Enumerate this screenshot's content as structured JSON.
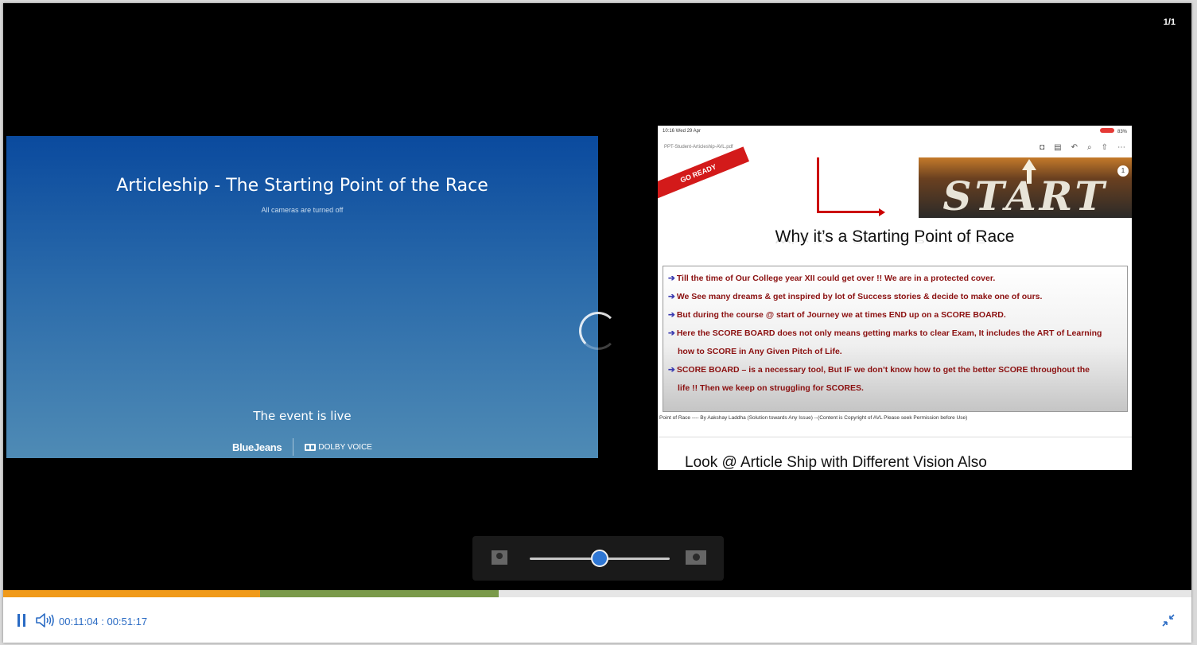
{
  "page_counter": "1/1",
  "event_panel": {
    "title": "Articleship - The Starting Point of the Race",
    "subtitle": "All cameras are turned off",
    "live_status": "The event is live",
    "brand_primary": "BlueJeans",
    "brand_secondary": "DOLBY VOICE"
  },
  "slide": {
    "status_time": "10:16  Wed 29 Apr",
    "status_battery": "83%",
    "file_name": "PPT-Student-Articleship-AVL.pdf",
    "ribbon_text": "GO READY",
    "start_text": "START",
    "page_badge": "1",
    "heading": "Why it’s a Starting Point of Race",
    "bullets": [
      "Till the time of Our College year XII could get over !! We are in a protected cover.",
      "We See many dreams & get inspired by lot of Success stories & decide to make one of ours.",
      "But during the course @ start of Journey we at times END up on a SCORE BOARD.",
      "Here the SCORE BOARD does not only means getting marks to clear Exam, It includes the ART of Learning",
      "how to SCORE in Any Given Pitch of Life.",
      "SCORE BOARD – is a necessary tool, But IF we don’t know how to get the better SCORE throughout the",
      "life !! Then we keep on struggling for SCORES."
    ],
    "footer": "Point of Race ---- By Aakshay Laddha (Solution towards Any Issue) --(Content is Copyright of AVL Please seek Permission before Use)",
    "next_heading": "Look @ Article Ship with Different Vision Also"
  },
  "layout_slider": {
    "value_fraction": 0.5
  },
  "playback": {
    "time": "00:11:04 : 00:51:17",
    "played_fraction": 0.216,
    "buffered_fraction": 0.417
  },
  "colors": {
    "accent": "#2a6bc4",
    "played": "#f09a1a",
    "buffered": "#7a9a4a",
    "panel_top": "#0a4a9e",
    "panel_bottom": "#4f8bb5"
  },
  "icons": {
    "pause": "pause-icon",
    "volume": "volume-icon",
    "exit_fullscreen": "exit-fullscreen-icon",
    "spinner": "loading-spinner-icon",
    "camera_left": "single-person-layout-icon",
    "camera_right": "screen-share-layout-icon"
  }
}
